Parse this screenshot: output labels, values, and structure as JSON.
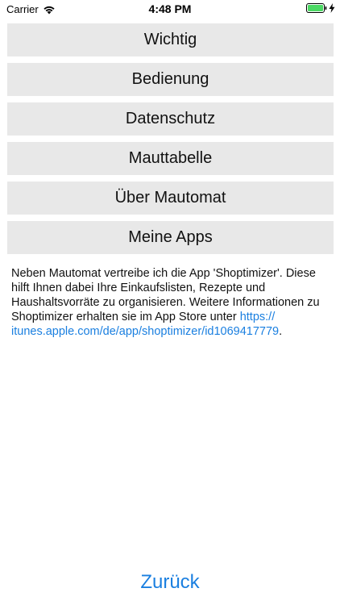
{
  "status_bar": {
    "carrier": "Carrier",
    "time": "4:48 PM",
    "battery_color": "#4cd964"
  },
  "menu": {
    "items": [
      {
        "label": "Wichtig"
      },
      {
        "label": "Bedienung"
      },
      {
        "label": "Datenschutz"
      },
      {
        "label": "Mauttabelle"
      },
      {
        "label": "Über Mautomat"
      },
      {
        "label": "Meine Apps"
      }
    ]
  },
  "description": {
    "text": "Neben Mautomat vertreibe ich die App 'Shoptimizer'. Diese hilft Ihnen dabei Ihre Einkaufslisten, Rezepte und Haushaltsvorräte zu organisieren. Weitere Informationen zu Shoptimizer erhalten sie im App Store unter ",
    "link_text": "https://​itunes.apple.com/de/app/shoptimizer/id1069417779",
    "trailing": "."
  },
  "footer": {
    "back_label": "Zurück"
  },
  "colors": {
    "accent": "#1a7fe0",
    "button_bg": "#e8e8e8"
  }
}
